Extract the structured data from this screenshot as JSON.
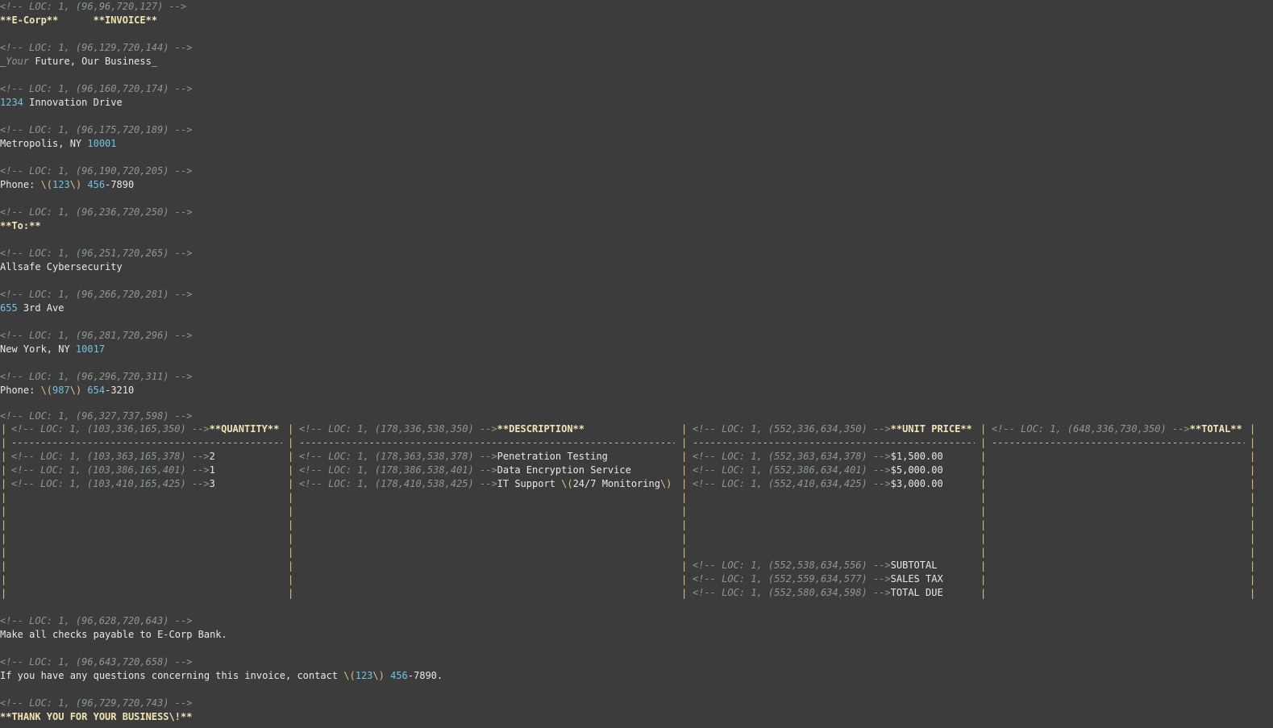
{
  "header": {
    "line1": {
      "comment": "<!-- LOC: 1, (96,96,720,127) -->",
      "company": "**E-Corp**",
      "gap": "      ",
      "invoice": "**INVOICE**"
    },
    "line2": {
      "comment": "<!-- LOC: 1, (96,129,720,144) -->",
      "u1": "_",
      "your": "Your",
      "rest": " Future, Our Business_"
    },
    "line3": {
      "comment": "<!-- LOC: 1, (96,160,720,174) -->",
      "num": "1234",
      "rest": " Innovation Drive"
    },
    "line4": {
      "comment": "<!-- LOC: 1, (96,175,720,189) -->",
      "pre": "Metropolis, NY ",
      "zip": "10001"
    },
    "line5": {
      "comment": "<!-- LOC: 1, (96,190,720,205) -->",
      "pre": "Phone: ",
      "lp": "\\(",
      "area": "123",
      "rp": "\\)",
      "sp": " ",
      "mid": "456",
      "tail": "-7890"
    }
  },
  "recipient": {
    "to": {
      "comment": "<!-- LOC: 1, (96,236,720,250) -->",
      "label": "**To:**"
    },
    "name": {
      "comment": "<!-- LOC: 1, (96,251,720,265) -->",
      "text": "Allsafe Cybersecurity"
    },
    "street": {
      "comment": "<!-- LOC: 1, (96,266,720,281) -->",
      "num": "655",
      "rest": " 3rd Ave"
    },
    "city": {
      "comment": "<!-- LOC: 1, (96,281,720,296) -->",
      "pre": "New York, NY ",
      "zip": "10017"
    },
    "phone": {
      "comment": "<!-- LOC: 1, (96,296,720,311) -->",
      "pre": "Phone: ",
      "lp": "\\(",
      "area": "987",
      "rp": "\\)",
      "sp": " ",
      "mid": "654",
      "tail": "-3210"
    }
  },
  "table": {
    "comment": "<!-- LOC: 1, (96,327,737,598) -->",
    "pipe": "|",
    "dashes": "------------------------------------------------------------------------------------------------------------------------",
    "headers": [
      {
        "comment": "<!-- LOC: 1, (103,336,165,350) -->",
        "label": "**QUANTITY**"
      },
      {
        "comment": "<!-- LOC: 1, (178,336,538,350) -->",
        "label": "**DESCRIPTION**"
      },
      {
        "comment": "<!-- LOC: 1, (552,336,634,350) -->",
        "label": "**UNIT PRICE**"
      },
      {
        "comment": "<!-- LOC: 1, (648,336,730,350) -->",
        "label": "**TOTAL**"
      }
    ],
    "quantity": [
      {
        "comment": "<!-- LOC: 1, (103,363,165,378) -->",
        "value": "2"
      },
      {
        "comment": "<!-- LOC: 1, (103,386,165,401) -->",
        "value": "1"
      },
      {
        "comment": "<!-- LOC: 1, (103,410,165,425) -->",
        "value": "3"
      }
    ],
    "description": [
      {
        "comment": "<!-- LOC: 1, (178,363,538,378) -->",
        "value": "Penetration Testing"
      },
      {
        "comment": "<!-- LOC: 1, (178,386,538,401) -->",
        "value": "Data Encryption Service"
      },
      {
        "comment": "<!-- LOC: 1, (178,410,538,425) -->",
        "pre": "IT Support ",
        "lp": "\\(",
        "mid": "24/7 Monitoring",
        "rp": "\\)"
      }
    ],
    "unit_price": [
      {
        "comment": "<!-- LOC: 1, (552,363,634,378) -->",
        "value": "$1,500.00"
      },
      {
        "comment": "<!-- LOC: 1, (552,386,634,401) -->",
        "value": "$5,000.00"
      },
      {
        "comment": "<!-- LOC: 1, (552,410,634,425) -->",
        "value": "$3,000.00"
      }
    ],
    "summary": [
      {
        "comment": "<!-- LOC: 1, (552,538,634,556) -->",
        "value": "SUBTOTAL"
      },
      {
        "comment": "<!-- LOC: 1, (552,559,634,577) -->",
        "value": "SALES TAX"
      },
      {
        "comment": "<!-- LOC: 1, (552,580,634,598) -->",
        "value": "TOTAL DUE"
      }
    ]
  },
  "footer": {
    "checks": {
      "comment": "<!-- LOC: 1, (96,628,720,643) -->",
      "text": "Make all checks payable to E-Corp Bank."
    },
    "questions": {
      "comment": "<!-- LOC: 1, (96,643,720,658) -->",
      "pre": "If you have any questions concerning this invoice, contact ",
      "lp": "\\(",
      "area": "123",
      "rp": "\\)",
      "sp": " ",
      "mid": "456",
      "tail": "-7890."
    },
    "thanks": {
      "comment": "<!-- LOC: 1, (96,729,720,743) -->",
      "text": "**THANK YOU FOR YOUR BUSINESS\\!**"
    }
  },
  "colors": {
    "background": "#3c3c3c",
    "comment": "#8a9a8a",
    "number": "#6fc3e0",
    "punctuation": "#e2c080",
    "bold": "#f2e3b3",
    "text": "#e8e8e8"
  }
}
